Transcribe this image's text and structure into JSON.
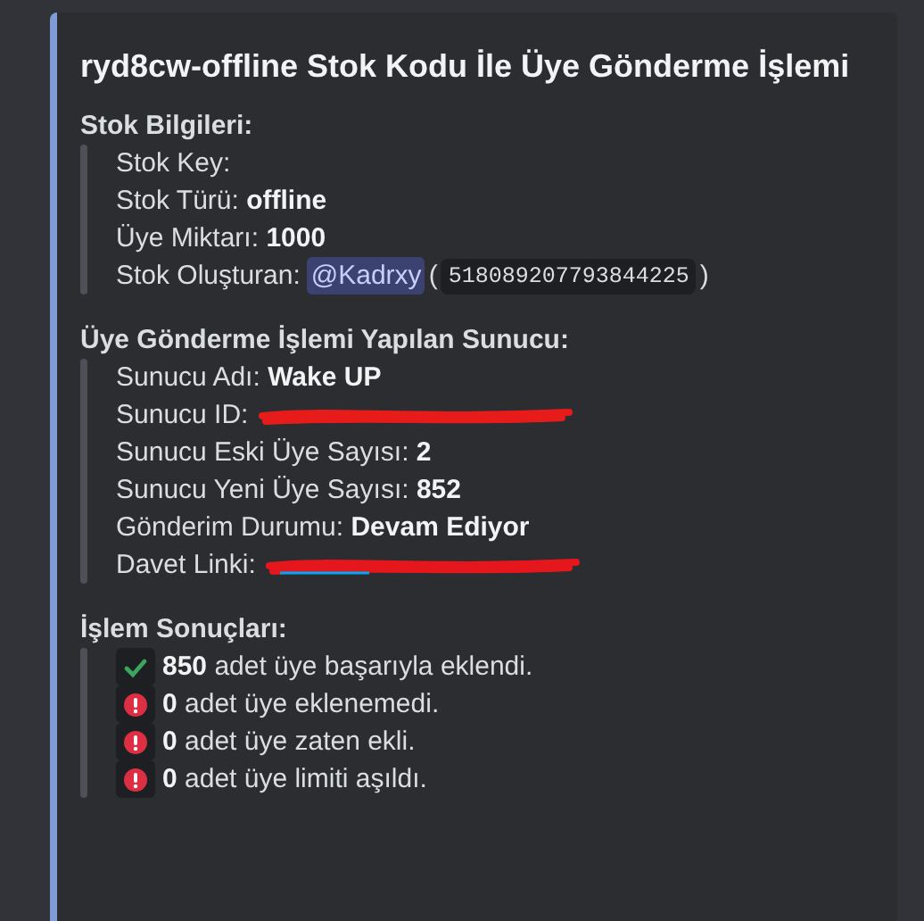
{
  "embed": {
    "title": "ryd8cw-offline Stok Kodu İle Üye Gönderme İşlemi",
    "sections": [
      {
        "heading": "Stok Bilgileri:",
        "lines": [
          {
            "kind": "plain",
            "label": "Stok Key:"
          },
          {
            "kind": "bold",
            "label": "Stok Türü:",
            "value": "offline"
          },
          {
            "kind": "bold",
            "label": "Üye Miktarı:",
            "value": "1000"
          },
          {
            "kind": "mention",
            "label": "Stok Oluşturan:",
            "mention": "@Kadrxy",
            "open": "(",
            "code": "518089207793844225",
            "close": ")"
          }
        ]
      },
      {
        "heading": "Üye Gönderme İşlemi Yapılan Sunucu:",
        "lines": [
          {
            "kind": "bold",
            "label": "Sunucu Adı:",
            "value": "Wake UP"
          },
          {
            "kind": "redacted",
            "label": "Sunucu ID:"
          },
          {
            "kind": "bold",
            "label": "Sunucu Eski Üye Sayısı:",
            "value": "2"
          },
          {
            "kind": "bold",
            "label": "Sunucu Yeni Üye Sayısı:",
            "value": "852"
          },
          {
            "kind": "bold",
            "label": "Gönderim Durumu:",
            "value": "Devam Ediyor"
          },
          {
            "kind": "redacted_link",
            "label": "Davet Linki:"
          }
        ]
      },
      {
        "heading": "İşlem Sonuçları:",
        "results": [
          {
            "kind": "success",
            "count": "850",
            "text": "adet üye başarıyla eklendi."
          },
          {
            "kind": "failure",
            "count": "0",
            "text": "adet üye eklenemedi."
          },
          {
            "kind": "failure",
            "count": "0",
            "text": "adet üye zaten ekli."
          },
          {
            "kind": "failure",
            "count": "0",
            "text": "adet üye limiti aşıldı."
          }
        ]
      }
    ]
  }
}
